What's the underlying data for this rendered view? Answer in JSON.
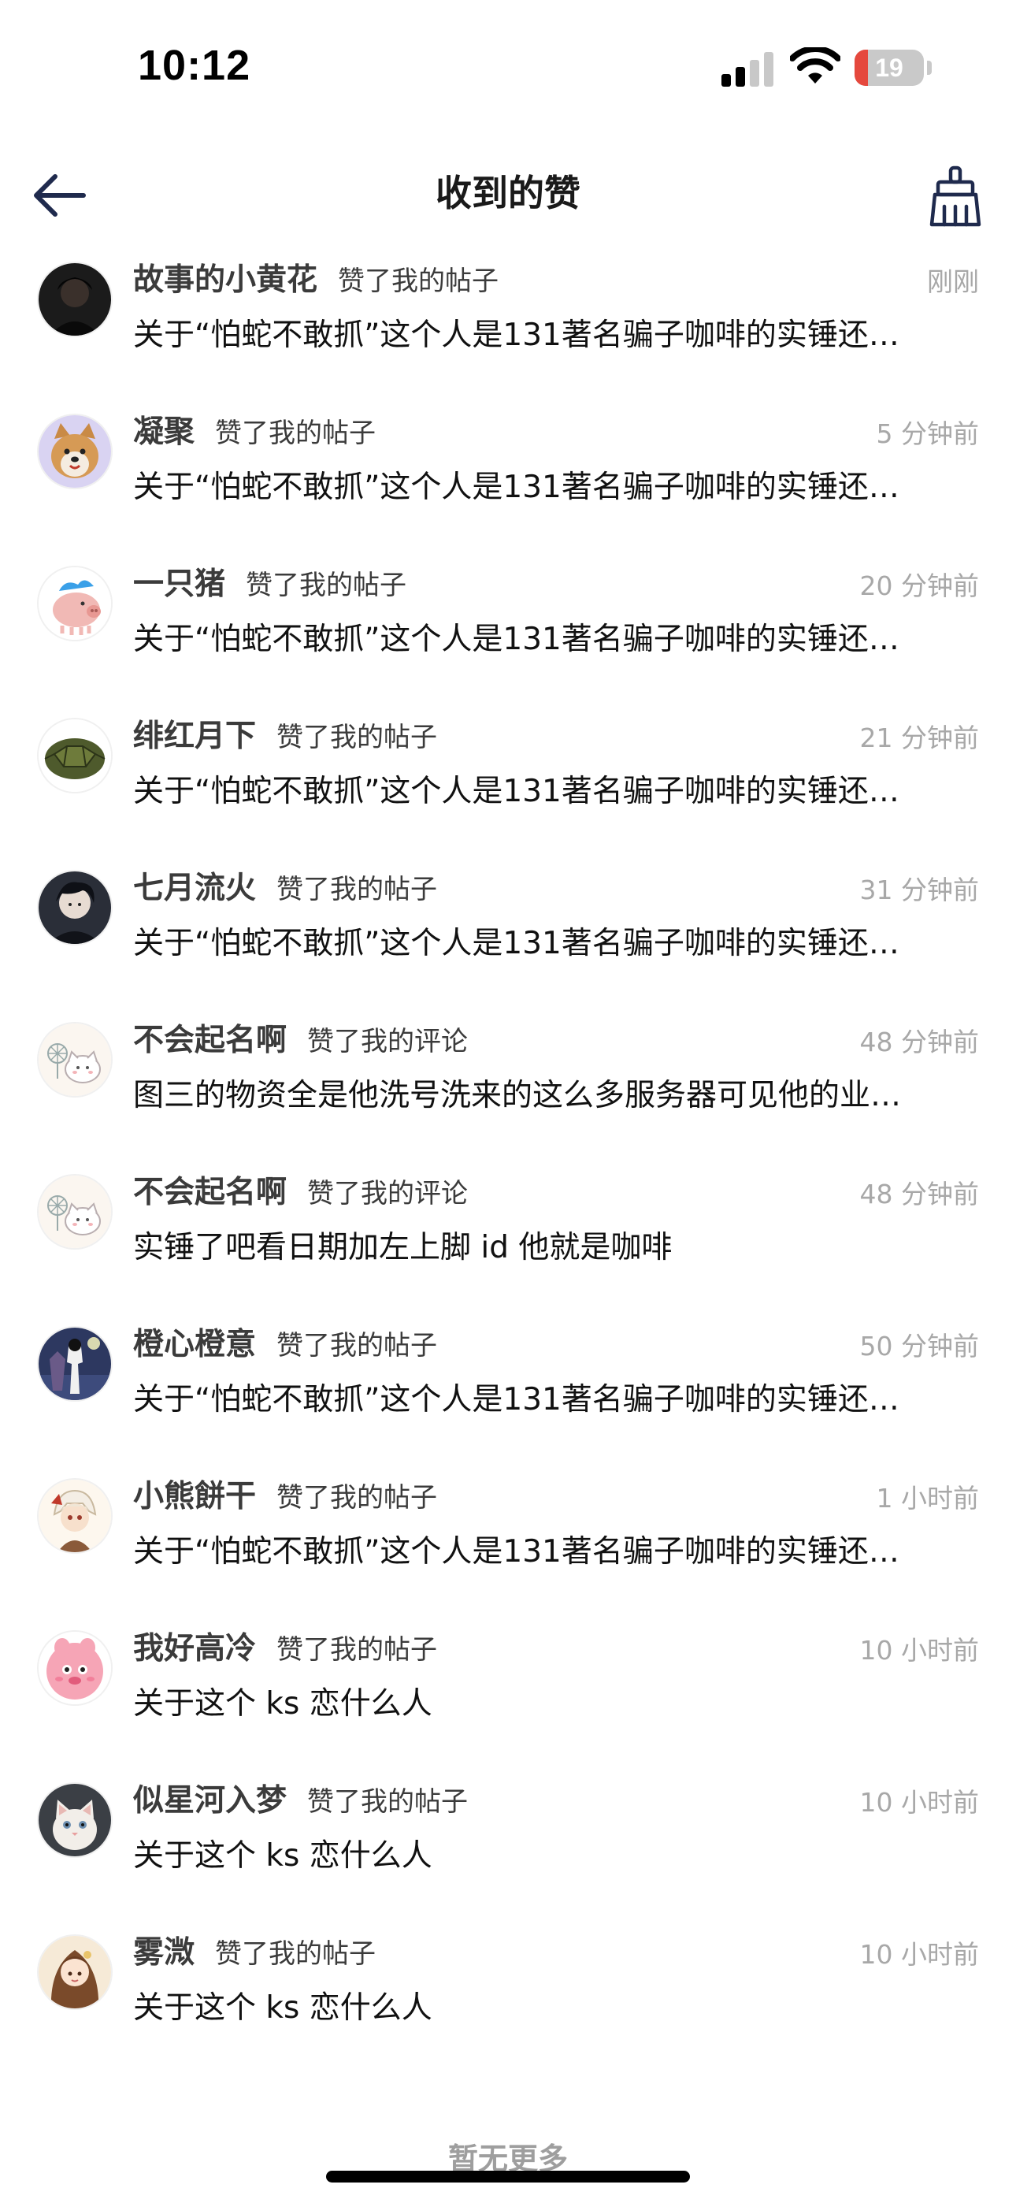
{
  "status_bar": {
    "time": "10:12",
    "battery_level": "19",
    "battery_color": "#e5483d",
    "icons": [
      "signal-icon",
      "wifi-icon",
      "battery-icon"
    ]
  },
  "nav": {
    "title": "收到的赞",
    "back_icon": "arrow-left-icon",
    "clean_icon": "broom-icon"
  },
  "likes": [
    {
      "user": "故事的小黄花",
      "action": "赞了我的帖子",
      "time": "刚刚",
      "snippet": "关于“怕蛇不敢抓”这个人是131著名骗子咖啡的实锤还…",
      "avatar": "avatar-dark-portrait"
    },
    {
      "user": "凝聚",
      "action": "赞了我的帖子",
      "time": "5 分钟前",
      "snippet": "关于“怕蛇不敢抓”这个人是131著名骗子咖啡的实锤还…",
      "avatar": "avatar-shiba-dog"
    },
    {
      "user": "一只猪",
      "action": "赞了我的帖子",
      "time": "20 分钟前",
      "snippet": "关于“怕蛇不敢抓”这个人是131著名骗子咖啡的实锤还…",
      "avatar": "avatar-pink-pig"
    },
    {
      "user": "绯红月下",
      "action": "赞了我的帖子",
      "time": "21 分钟前",
      "snippet": "关于“怕蛇不敢抓”这个人是131著名骗子咖啡的实锤还…",
      "avatar": "avatar-turtle-shell"
    },
    {
      "user": "七月流火",
      "action": "赞了我的帖子",
      "time": "31 分钟前",
      "snippet": "关于“怕蛇不敢抓”这个人是131著名骗子咖啡的实锤还…",
      "avatar": "avatar-anime-boy"
    },
    {
      "user": "不会起名啊",
      "action": "赞了我的评论",
      "time": "48 分钟前",
      "snippet": "图三的物资全是他洗号洗来的这么多服务器可见他的业…",
      "avatar": "avatar-white-cat-sketch"
    },
    {
      "user": "不会起名啊",
      "action": "赞了我的评论",
      "time": "48 分钟前",
      "snippet": "实锤了吧看日期加左上脚 id 他就是咖啡",
      "avatar": "avatar-white-cat-sketch"
    },
    {
      "user": "橙心橙意",
      "action": "赞了我的帖子",
      "time": "50 分钟前",
      "snippet": "关于“怕蛇不敢抓”这个人是131著名骗子咖啡的实锤还…",
      "avatar": "avatar-night-figure"
    },
    {
      "user": "小熊餅干",
      "action": "赞了我的帖子",
      "time": "1 小时前",
      "snippet": "关于“怕蛇不敢抓”这个人是131著名骗子咖啡的实锤还…",
      "avatar": "avatar-anime-character"
    },
    {
      "user": "我好高冷",
      "action": "赞了我的帖子",
      "time": "10 小时前",
      "snippet": "关于这个 ks 恋什么人",
      "avatar": "avatar-pink-blob"
    },
    {
      "user": "似星河入梦",
      "action": "赞了我的帖子",
      "time": "10 小时前",
      "snippet": "关于这个 ks 恋什么人",
      "avatar": "avatar-white-kitten"
    },
    {
      "user": "雾溦",
      "action": "赞了我的帖子",
      "time": "10 小时前",
      "snippet": "关于这个 ks 恋什么人",
      "avatar": "avatar-anime-girl"
    }
  ],
  "footer": {
    "no_more_text": "暂无更多"
  }
}
